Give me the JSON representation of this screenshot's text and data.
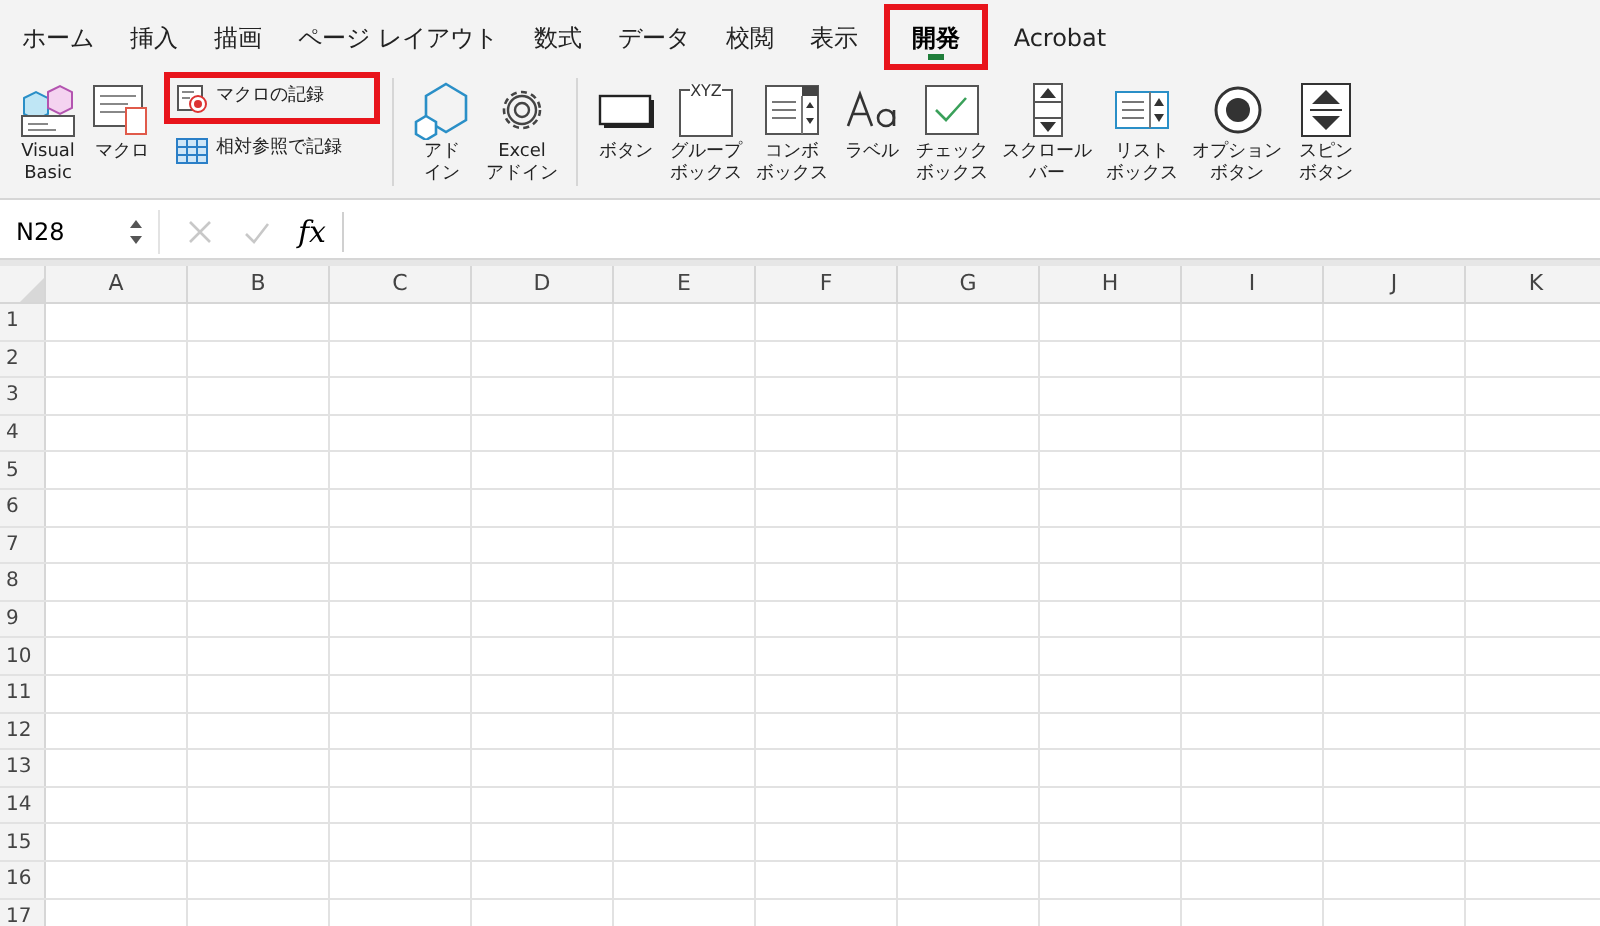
{
  "tabs": [
    {
      "label": "ホーム",
      "selected": false,
      "highlighted": false
    },
    {
      "label": "挿入",
      "selected": false,
      "highlighted": false
    },
    {
      "label": "描画",
      "selected": false,
      "highlighted": false
    },
    {
      "label": "ページ レイアウト",
      "selected": false,
      "highlighted": false
    },
    {
      "label": "数式",
      "selected": false,
      "highlighted": false
    },
    {
      "label": "データ",
      "selected": false,
      "highlighted": false
    },
    {
      "label": "校閲",
      "selected": false,
      "highlighted": false
    },
    {
      "label": "表示",
      "selected": false,
      "highlighted": false
    },
    {
      "label": "開発",
      "selected": true,
      "highlighted": true
    },
    {
      "label": "Acrobat",
      "selected": false,
      "highlighted": false
    }
  ],
  "ribbon": {
    "groups": [
      [
        {
          "kind": "vb",
          "label": [
            "Visual",
            "Basic"
          ]
        },
        {
          "kind": "macro",
          "label": [
            "マクロ"
          ]
        },
        {
          "kind": "stack",
          "items": [
            {
              "kind": "record",
              "label": "マクロの記録",
              "highlighted": true
            },
            {
              "kind": "relative",
              "label": "相対参照で記録",
              "highlighted": false
            }
          ]
        }
      ],
      [
        {
          "kind": "addin",
          "label": [
            "アド",
            "イン"
          ]
        },
        {
          "kind": "gear",
          "label": [
            "Excel",
            "アドイン"
          ]
        }
      ],
      [
        {
          "kind": "button",
          "label": [
            "ボタン"
          ]
        },
        {
          "kind": "group",
          "label": [
            "グループ",
            "ボックス"
          ],
          "icon_text": "XYZ"
        },
        {
          "kind": "combo",
          "label": [
            "コンボ",
            "ボックス"
          ]
        },
        {
          "kind": "label",
          "label": [
            "ラベル"
          ]
        },
        {
          "kind": "check",
          "label": [
            "チェック",
            "ボックス"
          ]
        },
        {
          "kind": "scroll",
          "label": [
            "スクロール",
            "バー"
          ]
        },
        {
          "kind": "list",
          "label": [
            "リスト",
            "ボックス"
          ]
        },
        {
          "kind": "option",
          "label": [
            "オプション",
            "ボタン"
          ]
        },
        {
          "kind": "spin",
          "label": [
            "スピン",
            "ボタン"
          ]
        }
      ]
    ]
  },
  "formula_bar": {
    "name_box": "N28",
    "fx": "fx"
  },
  "sheet": {
    "columns": [
      "A",
      "B",
      "C",
      "D",
      "E",
      "F",
      "G",
      "H",
      "I",
      "J",
      "K"
    ],
    "rows": [
      "1",
      "2",
      "3",
      "4",
      "5",
      "6",
      "7",
      "8",
      "9",
      "10",
      "11",
      "12",
      "13",
      "14",
      "15",
      "16",
      "17"
    ]
  }
}
